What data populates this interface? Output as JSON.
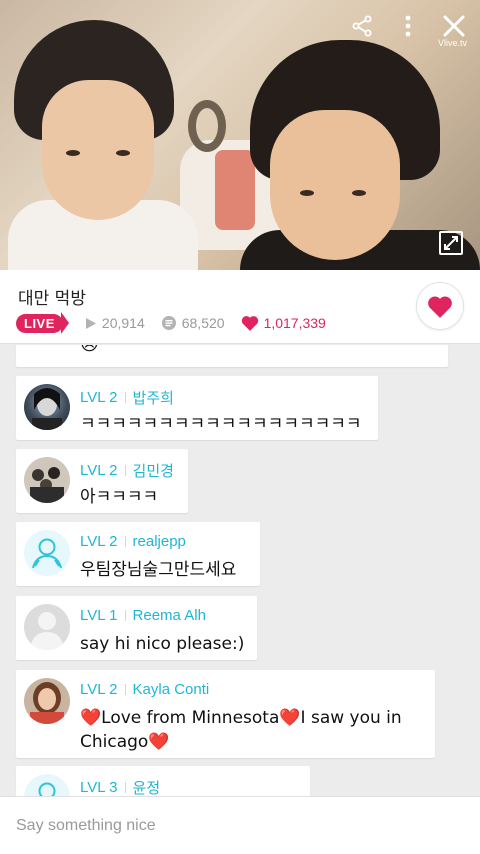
{
  "video": {
    "brand": "Vlive.tv"
  },
  "info": {
    "title": "대만 먹방",
    "live_label": "LIVE",
    "views": "20,914",
    "comments": "68,520",
    "likes": "1,017,339"
  },
  "chat": {
    "messages": [
      {
        "level": "",
        "name": "",
        "text": "😢"
      },
      {
        "level": "LVL 2",
        "name": "밥주희",
        "text": "ㅋㅋㅋㅋㅋㅋㅋㅋㅋㅋㅋㅋㅋㅋㅋㅋㅋㅋ"
      },
      {
        "level": "LVL 2",
        "name": "김민경",
        "text": "아ㅋㅋㅋㅋ"
      },
      {
        "level": "LVL 2",
        "name": "realjepp",
        "text": "우팀장님술그만드세요"
      },
      {
        "level": "LVL 1",
        "name": "Reema Alh",
        "text": "say hi nico please:)"
      },
      {
        "level": "LVL 2",
        "name": "Kayla Conti",
        "text_a": "Love from Minnesota",
        "text_b": "I saw you in",
        "text_c": "Chicago"
      },
      {
        "level": "LVL 3",
        "name": "윤정",
        "text": ""
      }
    ]
  },
  "input": {
    "placeholder": "Say something nice"
  },
  "colors": {
    "accent": "#e0245e",
    "chat_meta": "#1fb6d6"
  }
}
